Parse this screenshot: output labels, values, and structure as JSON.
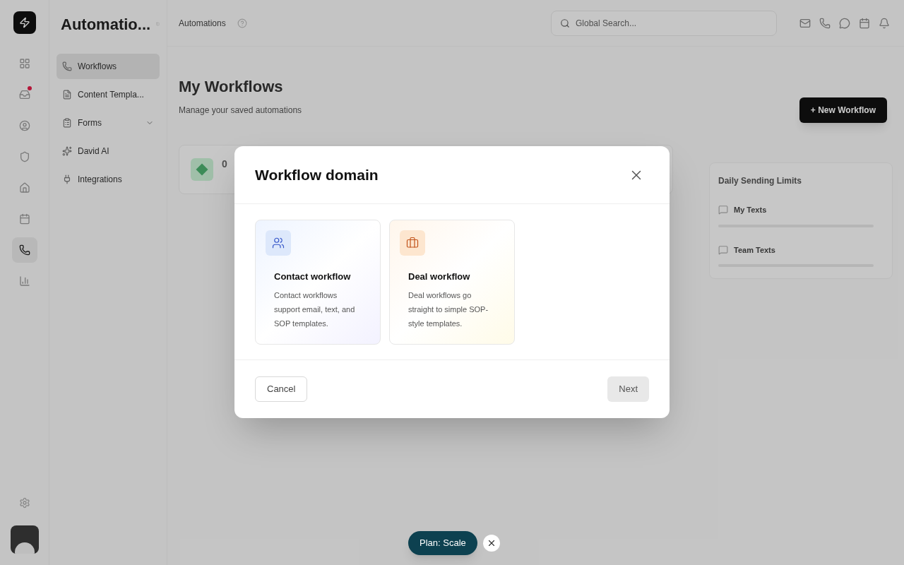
{
  "app": {
    "title": "Automatio..."
  },
  "rail": [
    {
      "selected": false,
      "badge": false
    },
    {
      "selected": false,
      "badge": true
    },
    {
      "selected": false,
      "badge": false
    },
    {
      "selected": false,
      "badge": false
    },
    {
      "selected": false,
      "badge": false
    },
    {
      "selected": false,
      "badge": false
    },
    {
      "selected": true,
      "badge": false
    },
    {
      "selected": false,
      "badge": false
    }
  ],
  "sidebar": {
    "items": [
      {
        "label": "Workflows",
        "selected": true,
        "has_children": false
      },
      {
        "label": "Content Templa...",
        "selected": false,
        "has_children": false
      },
      {
        "label": "Forms",
        "selected": false,
        "has_children": true
      },
      {
        "label": "David AI",
        "selected": false,
        "has_children": false
      },
      {
        "label": "Integrations",
        "selected": false,
        "has_children": false
      }
    ]
  },
  "header": {
    "breadcrumb": "Automations",
    "search": {
      "placeholder": "Global Search..."
    }
  },
  "page": {
    "title": "My Workflows",
    "subtitle": "Manage your saved automations",
    "new_button": "+ New Workflow",
    "stat": {
      "value": "0"
    }
  },
  "limits": {
    "title": "Daily Sending Limits",
    "rows": [
      {
        "label": "My Texts"
      },
      {
        "label": "Team Texts"
      }
    ]
  },
  "dialog": {
    "title": "Workflow domain",
    "options": [
      {
        "kind": "contact",
        "title": "Contact workflow",
        "description": "Contact workflows support email, text, and SOP templates.",
        "selected": false
      },
      {
        "kind": "deal",
        "title": "Deal workflow",
        "description": "Deal workflows go straight to simple SOP-style templates.",
        "selected": false
      }
    ],
    "cancel": "Cancel",
    "next": "Next",
    "next_disabled": true
  },
  "plan_badge": {
    "label": "Plan: Scale"
  }
}
